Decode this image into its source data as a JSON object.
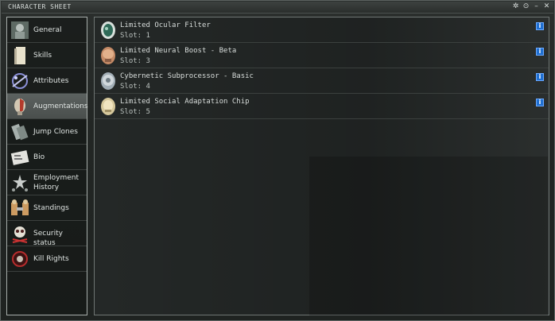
{
  "window": {
    "title": "CHARACTER SHEET",
    "controls": [
      "✲",
      "⊙",
      "–",
      "✕"
    ]
  },
  "sidebar": {
    "items": [
      {
        "label": "General",
        "icon": "general-icon"
      },
      {
        "label": "Skills",
        "icon": "skills-icon"
      },
      {
        "label": "Attributes",
        "icon": "attributes-icon"
      },
      {
        "label": "Augmentations",
        "icon": "augmentations-icon",
        "selected": true
      },
      {
        "label": "Jump Clones",
        "icon": "jump-clones-icon"
      },
      {
        "label": "Bio",
        "icon": "bio-icon"
      },
      {
        "label": "Employment History",
        "line1": "Employment",
        "line2": "History",
        "icon": "employment-history-icon"
      },
      {
        "label": "Standings",
        "icon": "standings-icon"
      },
      {
        "label": "Security status",
        "icon": "security-status-icon"
      },
      {
        "label": "Kill Rights",
        "icon": "kill-rights-icon"
      }
    ]
  },
  "implants": [
    {
      "name": "Limited Ocular Filter",
      "slot": "Slot: 1",
      "color": "#3a6a57"
    },
    {
      "name": "Limited Neural Boost - Beta",
      "slot": "Slot: 3",
      "color": "#b27351"
    },
    {
      "name": "Cybernetic Subprocessor - Basic",
      "slot": "Slot: 4",
      "color": "#8d9aa2"
    },
    {
      "name": "Limited Social Adaptation Chip",
      "slot": "Slot: 5",
      "color": "#c9b78c"
    }
  ],
  "info_button_label": "i"
}
